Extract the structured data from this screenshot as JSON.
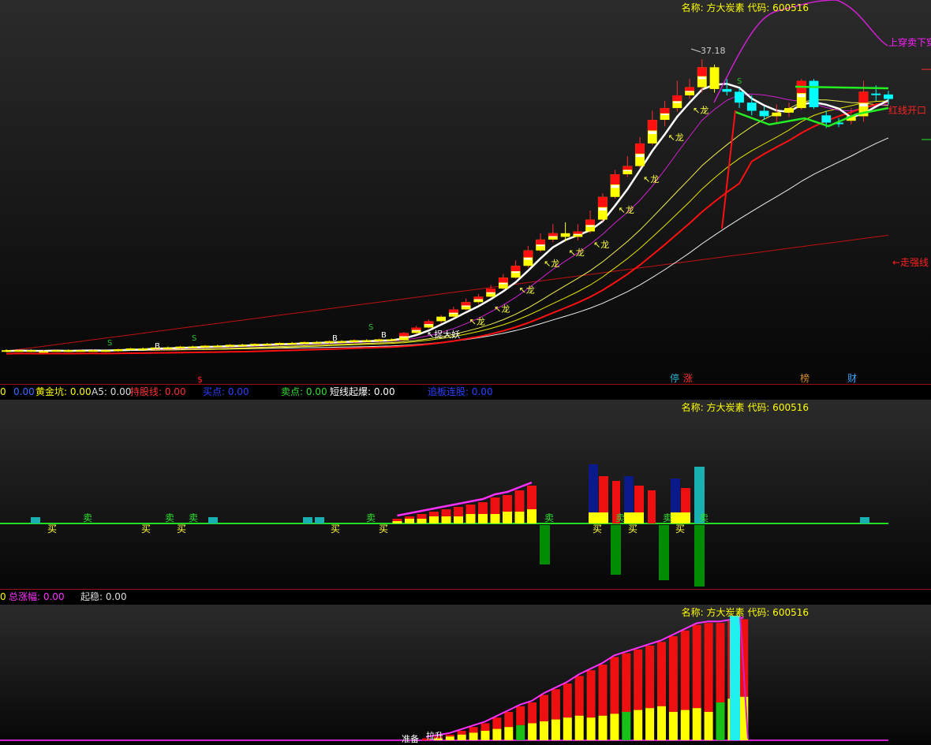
{
  "title": {
    "main": "名称: 方大炭素 代码: 600516",
    "sub": "名称: 方大炭素 代码: 600516",
    "third": "名称: 方大炭素 代码: 600516"
  },
  "colors": {
    "up": "#ff0000",
    "down": "#00ffff",
    "yellow": "#ffff00",
    "magenta": "#ff00ff",
    "green": "#00ff00",
    "white": "#ffffff",
    "red_line": "#dd1111",
    "dark_blue": "#0a1a8a",
    "dark_green": "#008c00",
    "cyan": "#22cfcf",
    "teal": "#18b0b0"
  },
  "main_panel": {
    "labels": {
      "up_cross": "上穿卖下穿",
      "red_open": "红线开口",
      "go_strong": "←走强线",
      "high_price": "37.18",
      "catch_demon": "↖捉大妖",
      "dragon": "↖龙",
      "mark_s": "S",
      "mark_b": "B",
      "mark_dollar": "$"
    },
    "badges": [
      {
        "text": "停",
        "color": "#2ab0d0"
      },
      {
        "text": "涨",
        "color": "#ff3030"
      },
      {
        "text": "榜",
        "color": "#d28a2a"
      },
      {
        "text": "财",
        "color": "#3aa6ff"
      }
    ]
  },
  "indicator_bar_1": [
    {
      "text": "0",
      "color": "#ffff00"
    },
    {
      "text": "0.00",
      "color": "#3a6bff"
    },
    {
      "text": "黄金坑: 0.00",
      "color": "#ffff00"
    },
    {
      "text": "A5: 0.00",
      "color": "#dddddd"
    },
    {
      "text": "持股线: 0.00",
      "color": "#ff3030"
    },
    {
      "text": "买点: 0.00",
      "color": "#2a40ff"
    },
    {
      "text": "卖点: 0.00",
      "color": "#30e030"
    },
    {
      "text": "短线起爆: 0.00",
      "color": "#ffffff"
    },
    {
      "text": "追板连股: 0.00",
      "color": "#2a40ff"
    }
  ],
  "indicator_bar_2": [
    {
      "text": "0",
      "color": "#ffff00"
    },
    {
      "text": "总涨幅: 0.00",
      "color": "#ff30ff"
    },
    {
      "text": "起稳: 0.00",
      "color": "#dddddd"
    }
  ],
  "panel2_labels": {
    "buy": "买",
    "sell": "卖"
  },
  "panel3_labels": {
    "prepare": "准备",
    "lift": "拉升"
  },
  "chart_data": [
    {
      "type": "candlestick",
      "panel": "main",
      "candles": [
        {
          "o": 5.1,
          "c": 5.0,
          "h": 5.2,
          "l": 4.9
        },
        {
          "o": 5.0,
          "c": 5.1,
          "h": 5.2,
          "l": 4.9
        },
        {
          "o": 5.1,
          "c": 5.0,
          "h": 5.2,
          "l": 4.9
        },
        {
          "o": 5.0,
          "c": 5.0,
          "h": 5.1,
          "l": 4.9
        },
        {
          "o": 5.0,
          "c": 5.1,
          "h": 5.2,
          "l": 4.9
        },
        {
          "o": 5.1,
          "c": 5.0,
          "h": 5.2,
          "l": 4.9
        },
        {
          "o": 5.0,
          "c": 5.1,
          "h": 5.2,
          "l": 4.9
        },
        {
          "o": 5.1,
          "c": 5.1,
          "h": 5.2,
          "l": 5.0
        },
        {
          "o": 5.1,
          "c": 5.0,
          "h": 5.2,
          "l": 4.9
        },
        {
          "o": 5.0,
          "c": 5.2,
          "h": 5.3,
          "l": 4.9
        },
        {
          "o": 5.2,
          "c": 5.3,
          "h": 5.4,
          "l": 5.1
        },
        {
          "o": 5.3,
          "c": 5.2,
          "h": 5.4,
          "l": 5.1
        },
        {
          "o": 5.2,
          "c": 5.4,
          "h": 5.5,
          "l": 5.1
        },
        {
          "o": 5.4,
          "c": 5.3,
          "h": 5.5,
          "l": 5.2
        },
        {
          "o": 5.3,
          "c": 5.5,
          "h": 5.6,
          "l": 5.2
        },
        {
          "o": 5.5,
          "c": 5.4,
          "h": 5.6,
          "l": 5.3
        },
        {
          "o": 5.4,
          "c": 5.6,
          "h": 5.7,
          "l": 5.3
        },
        {
          "o": 5.6,
          "c": 5.5,
          "h": 5.7,
          "l": 5.4
        },
        {
          "o": 5.5,
          "c": 5.7,
          "h": 5.8,
          "l": 5.4
        },
        {
          "o": 5.7,
          "c": 5.6,
          "h": 5.8,
          "l": 5.5
        },
        {
          "o": 5.6,
          "c": 5.8,
          "h": 5.9,
          "l": 5.5
        },
        {
          "o": 5.8,
          "c": 5.7,
          "h": 5.9,
          "l": 5.6
        },
        {
          "o": 5.7,
          "c": 5.9,
          "h": 6.0,
          "l": 5.6
        },
        {
          "o": 5.9,
          "c": 5.8,
          "h": 6.0,
          "l": 5.7
        },
        {
          "o": 5.8,
          "c": 6.0,
          "h": 6.1,
          "l": 5.7
        },
        {
          "o": 6.0,
          "c": 5.9,
          "h": 6.1,
          "l": 5.8
        },
        {
          "o": 5.9,
          "c": 6.1,
          "h": 6.2,
          "l": 5.8
        },
        {
          "o": 6.1,
          "c": 6.0,
          "h": 6.2,
          "l": 5.9
        },
        {
          "o": 6.0,
          "c": 6.2,
          "h": 6.3,
          "l": 5.9
        },
        {
          "o": 6.2,
          "c": 6.1,
          "h": 6.3,
          "l": 6.0
        },
        {
          "o": 6.1,
          "c": 6.3,
          "h": 6.4,
          "l": 6.0
        },
        {
          "o": 6.3,
          "c": 6.2,
          "h": 6.4,
          "l": 6.1
        },
        {
          "o": 6.2,
          "c": 7.0,
          "h": 7.1,
          "l": 6.1
        },
        {
          "o": 7.0,
          "c": 7.6,
          "h": 7.8,
          "l": 6.9
        },
        {
          "o": 7.6,
          "c": 8.3,
          "h": 8.5,
          "l": 7.5
        },
        {
          "o": 8.3,
          "c": 8.8,
          "h": 9.0,
          "l": 8.1
        },
        {
          "o": 8.8,
          "c": 9.6,
          "h": 9.9,
          "l": 8.7
        },
        {
          "o": 9.6,
          "c": 10.4,
          "h": 10.8,
          "l": 9.5
        },
        {
          "o": 10.4,
          "c": 11.0,
          "h": 11.3,
          "l": 10.2
        },
        {
          "o": 11.0,
          "c": 11.9,
          "h": 12.3,
          "l": 10.9
        },
        {
          "o": 11.9,
          "c": 13.1,
          "h": 13.5,
          "l": 11.8
        },
        {
          "o": 13.1,
          "c": 14.4,
          "h": 15.0,
          "l": 13.0
        },
        {
          "o": 14.4,
          "c": 16.1,
          "h": 16.6,
          "l": 14.2
        },
        {
          "o": 16.1,
          "c": 17.3,
          "h": 18.0,
          "l": 15.9
        },
        {
          "o": 17.3,
          "c": 18.0,
          "h": 19.0,
          "l": 17.0
        },
        {
          "o": 18.0,
          "c": 17.6,
          "h": 19.2,
          "l": 17.1
        },
        {
          "o": 17.6,
          "c": 18.2,
          "h": 19.0,
          "l": 17.2
        },
        {
          "o": 18.2,
          "c": 19.5,
          "h": 20.5,
          "l": 18.0
        },
        {
          "o": 19.5,
          "c": 22.0,
          "h": 22.4,
          "l": 19.3
        },
        {
          "o": 22.0,
          "c": 24.5,
          "h": 25.0,
          "l": 21.8
        },
        {
          "o": 24.5,
          "c": 25.4,
          "h": 26.5,
          "l": 24.2
        },
        {
          "o": 25.4,
          "c": 27.9,
          "h": 28.6,
          "l": 25.2
        },
        {
          "o": 27.9,
          "c": 30.5,
          "h": 31.5,
          "l": 27.7
        },
        {
          "o": 30.5,
          "c": 31.8,
          "h": 32.6,
          "l": 29.8
        },
        {
          "o": 31.8,
          "c": 33.2,
          "h": 34.8,
          "l": 31.4
        },
        {
          "o": 33.2,
          "c": 34.1,
          "h": 35.0,
          "l": 32.8
        },
        {
          "o": 34.1,
          "c": 36.3,
          "h": 37.18,
          "l": 33.5
        },
        {
          "o": 36.3,
          "c": 33.9,
          "h": 36.6,
          "l": 33.5
        },
        {
          "o": 33.9,
          "c": 33.6,
          "h": 35.0,
          "l": 33.2
        },
        {
          "o": 33.6,
          "c": 32.4,
          "h": 34.0,
          "l": 31.8
        },
        {
          "o": 32.4,
          "c": 31.5,
          "h": 33.2,
          "l": 31.0
        },
        {
          "o": 31.5,
          "c": 30.9,
          "h": 32.0,
          "l": 30.5
        },
        {
          "o": 30.9,
          "c": 31.3,
          "h": 32.2,
          "l": 30.2
        },
        {
          "o": 31.3,
          "c": 31.8,
          "h": 32.4,
          "l": 30.8
        },
        {
          "o": 31.8,
          "c": 34.8,
          "h": 35.0,
          "l": 31.6
        },
        {
          "o": 34.8,
          "c": 31.9,
          "h": 35.0,
          "l": 31.7
        },
        {
          "o": 31.0,
          "c": 30.2,
          "h": 31.5,
          "l": 29.6
        },
        {
          "o": 30.2,
          "c": 30.1,
          "h": 30.7,
          "l": 29.7
        },
        {
          "o": 30.4,
          "c": 30.9,
          "h": 31.8,
          "l": 30.0
        },
        {
          "o": 30.9,
          "c": 33.6,
          "h": 34.8,
          "l": 30.3
        },
        {
          "o": 33.4,
          "c": 33.3,
          "h": 34.3,
          "l": 32.6
        },
        {
          "o": 33.3,
          "c": 32.8,
          "h": 33.7,
          "l": 32.2
        }
      ]
    },
    {
      "type": "bar",
      "panel": "indicator-2",
      "series": [
        {
          "values": [
            0,
            0,
            0,
            0,
            0,
            0,
            0,
            0,
            0,
            0,
            0,
            0,
            0,
            0,
            0,
            0,
            0,
            0,
            0,
            0,
            0,
            0,
            0,
            0,
            0,
            0,
            0,
            0,
            0,
            0,
            0,
            0,
            1,
            1,
            2,
            2,
            3,
            3,
            3,
            4,
            4,
            4,
            5,
            5,
            6,
            0,
            0,
            0,
            0,
            0,
            0,
            0,
            0,
            0,
            0,
            0,
            0,
            0,
            0,
            0,
            0,
            0,
            0,
            0,
            0,
            0,
            0,
            0,
            0,
            0,
            0,
            0
          ]
        },
        {
          "values": [
            0,
            0,
            0,
            0,
            0,
            0,
            0,
            0,
            0,
            0,
            0,
            0,
            0,
            0,
            0,
            0,
            0,
            0,
            0,
            0,
            0,
            0,
            0,
            0,
            0,
            0,
            0,
            0,
            0,
            0,
            0,
            0,
            0,
            2,
            3,
            4,
            5,
            6,
            7,
            8,
            9,
            11,
            12,
            14,
            16,
            0,
            0,
            0,
            0,
            0,
            0,
            0,
            0,
            0,
            0,
            0,
            0,
            0,
            0,
            0,
            0,
            0,
            0,
            0,
            0,
            0,
            0,
            0,
            0,
            0,
            0,
            0
          ]
        }
      ]
    },
    {
      "type": "bar",
      "panel": "indicator-3",
      "series": [
        {
          "values": [
            0,
            0,
            0,
            0,
            0,
            0,
            0,
            0,
            0,
            0,
            0,
            0,
            0,
            0,
            0,
            0,
            0,
            0,
            0,
            0,
            0,
            0,
            0,
            0,
            0,
            0,
            0,
            0,
            0,
            0,
            0,
            0,
            0,
            1,
            2,
            3,
            4,
            5,
            6,
            7,
            8,
            9,
            10,
            11,
            12,
            13,
            12,
            13,
            14,
            15,
            16,
            17,
            18,
            15,
            16,
            17,
            15,
            20,
            22,
            23
          ]
        },
        {
          "values": [
            0,
            0,
            0,
            0,
            0,
            0,
            0,
            0,
            0,
            0,
            0,
            0,
            0,
            0,
            0,
            0,
            0,
            0,
            0,
            0,
            0,
            0,
            0,
            0,
            0,
            0,
            0,
            0,
            0,
            0,
            0,
            0,
            1,
            2,
            3,
            5,
            7,
            9,
            12,
            15,
            18,
            20,
            24,
            27,
            30,
            34,
            37,
            40,
            44,
            46,
            48,
            50,
            52,
            55,
            58,
            61,
            62,
            62,
            63,
            64
          ]
        }
      ]
    }
  ]
}
